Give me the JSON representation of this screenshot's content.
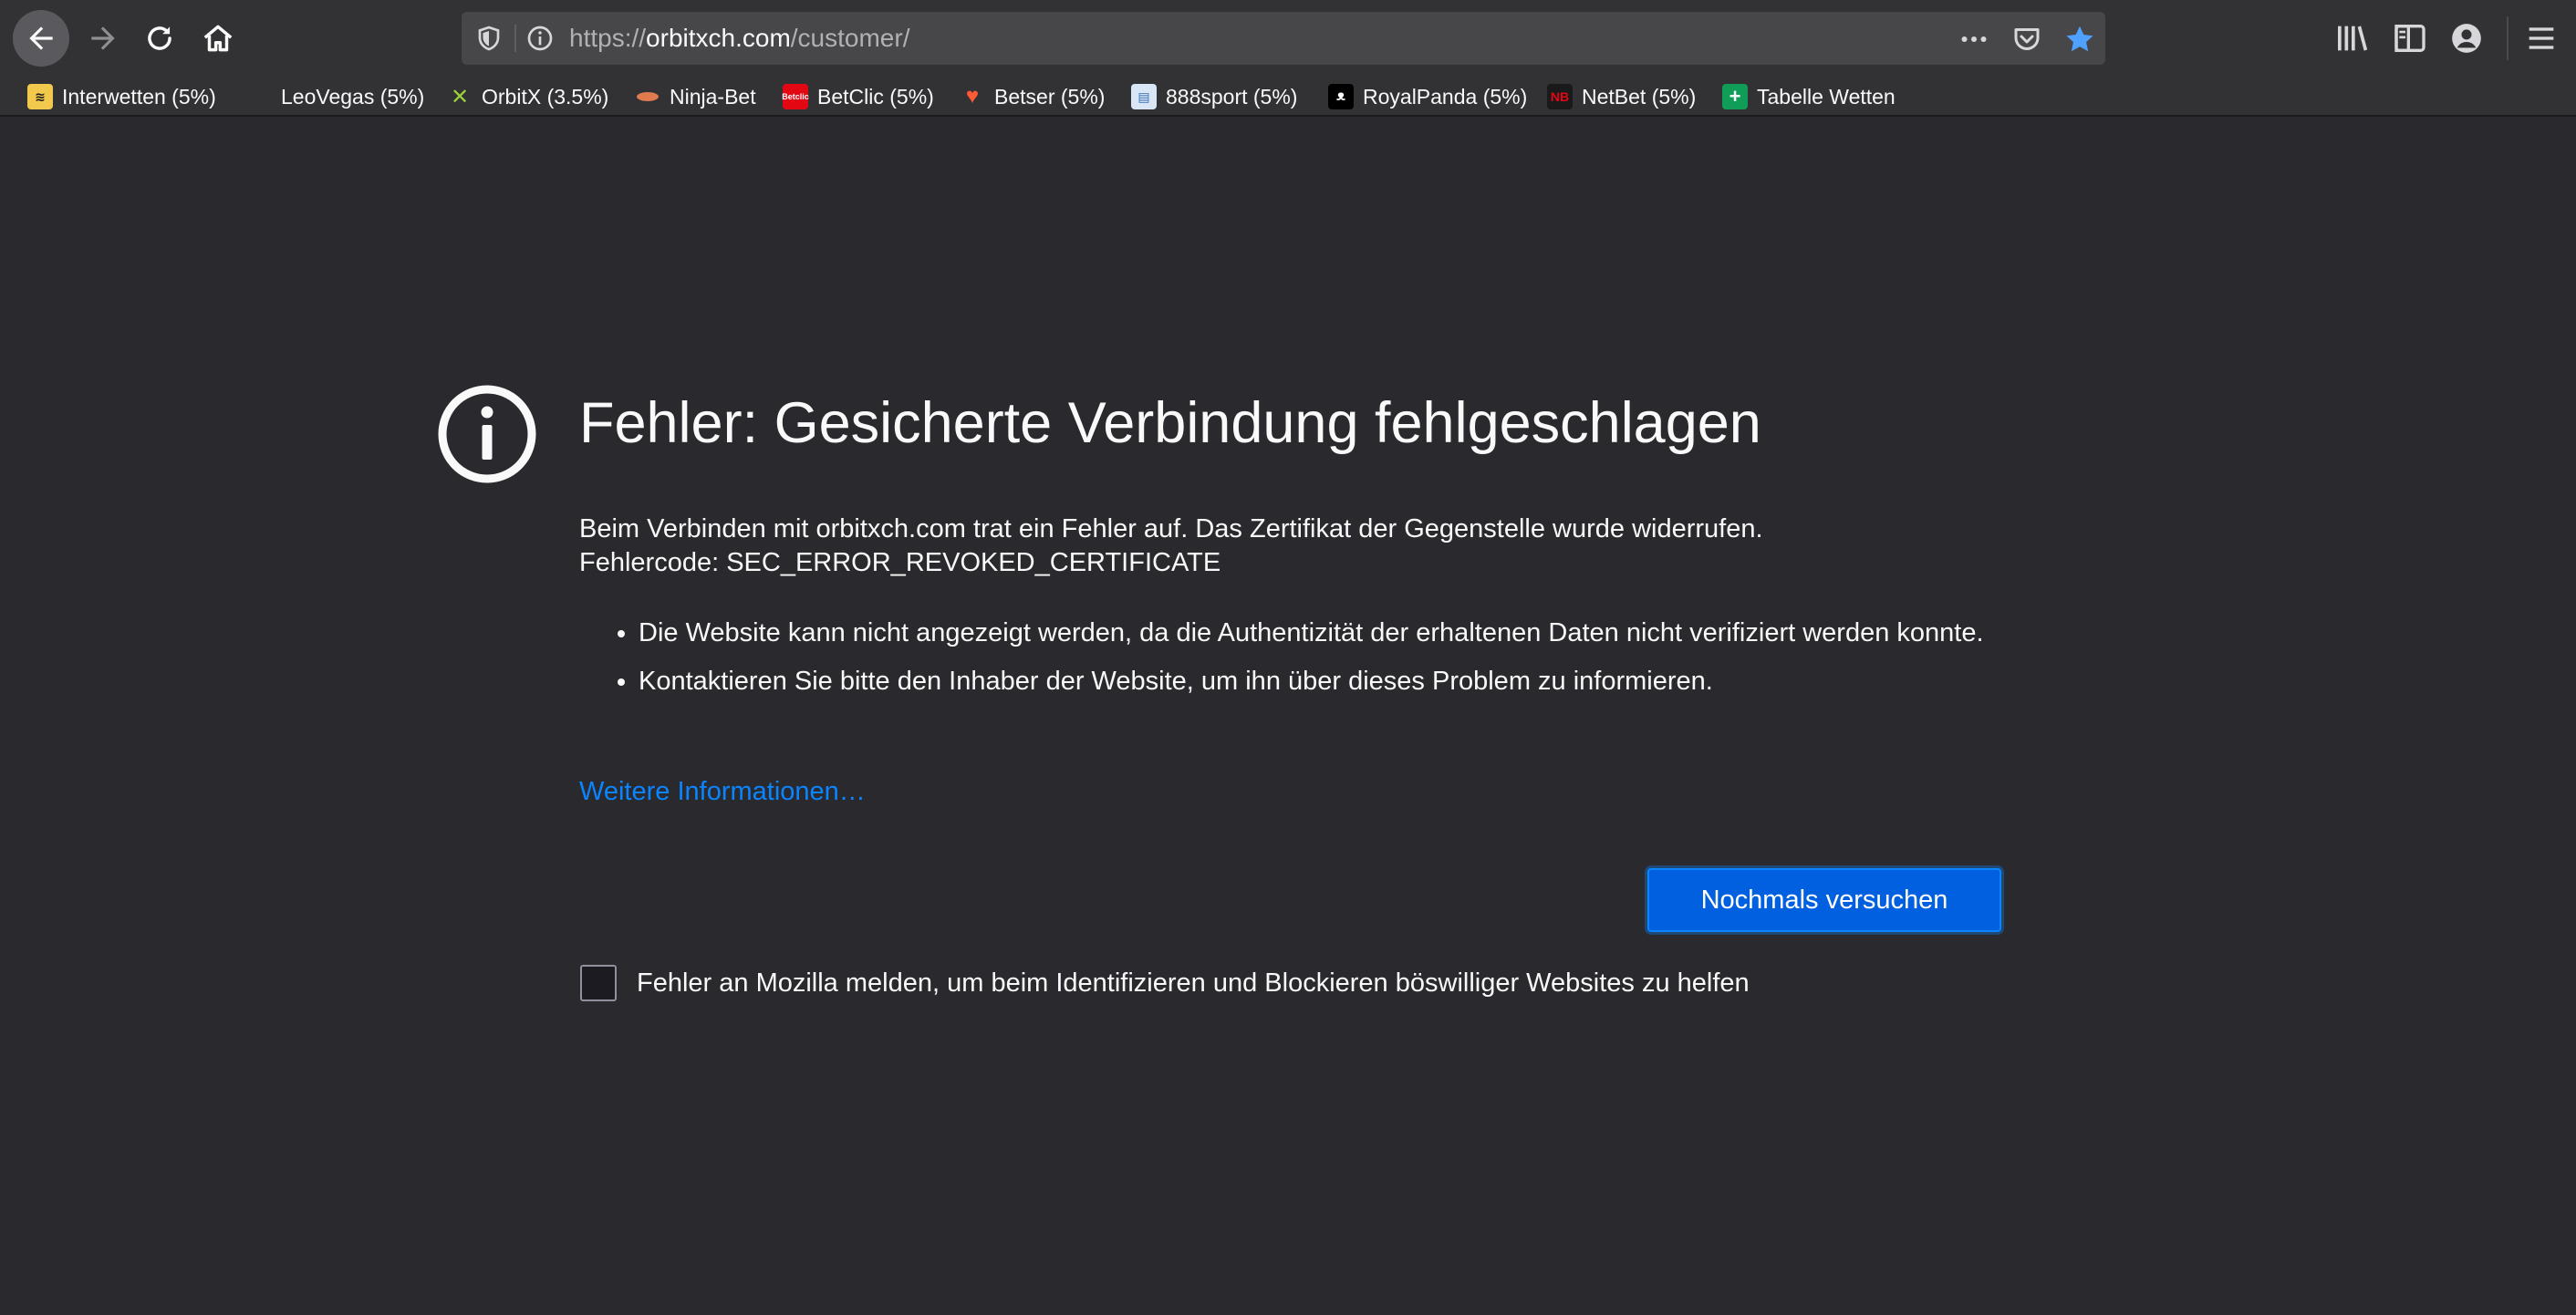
{
  "browser": {
    "url": {
      "scheme": "https://",
      "host": "orbitxch.com",
      "path": "/customer/"
    }
  },
  "bookmarks": [
    {
      "label": "Interwetten (5%)",
      "icon": "interwetten-favicon",
      "color": "#f2c94c"
    },
    {
      "label": "LeoVegas (5%)",
      "icon": "leovegas-favicon",
      "color": "#323234"
    },
    {
      "label": "OrbitX (3.5%)",
      "icon": "orbitx-favicon",
      "color": "#9ad13b"
    },
    {
      "label": "Ninja-Bet",
      "icon": "ninjabet-favicon",
      "color": "#e07a4f"
    },
    {
      "label": "BetClic (5%)",
      "icon": "betclic-favicon",
      "color": "#e30613"
    },
    {
      "label": "Betser (5%)",
      "icon": "betser-favicon",
      "color": "#ff5a36"
    },
    {
      "label": "888sport (5%)",
      "icon": "888sport-favicon",
      "color": "#d9e6f5"
    },
    {
      "label": "RoyalPanda (5%)",
      "icon": "royalpanda-favicon",
      "color": "#000000"
    },
    {
      "label": "NetBet (5%)",
      "icon": "netbet-favicon",
      "color": "#1a1a1a"
    },
    {
      "label": "Tabelle Wetten",
      "icon": "sheets-favicon",
      "color": "#0f9d58"
    }
  ],
  "error": {
    "title": "Fehler: Gesicherte Verbindung fehlgeschlagen",
    "description": "Beim Verbinden mit orbitxch.com trat ein Fehler auf. Das Zertifikat der Gegenstelle wurde widerrufen.",
    "code": "Fehlercode: SEC_ERROR_REVOKED_CERTIFICATE",
    "bullets": [
      "Die Website kann nicht angezeigt werden, da die Authentizität der erhaltenen Daten nicht verifiziert werden konnte.",
      "Kontaktieren Sie bitte den Inhaber der Website, um ihn über dieses Problem zu informieren."
    ],
    "more_info_link": "Weitere Informationen…",
    "retry_button": "Nochmals versuchen",
    "report_label": "Fehler an Mozilla melden, um beim Identifizieren und Blockieren böswilliger Websites zu helfen",
    "report_checked": false
  },
  "colors": {
    "page_bg": "#2a2a2e",
    "toolbar_bg": "#323234",
    "accent": "#0a84ff",
    "button_bg": "#0060df"
  }
}
